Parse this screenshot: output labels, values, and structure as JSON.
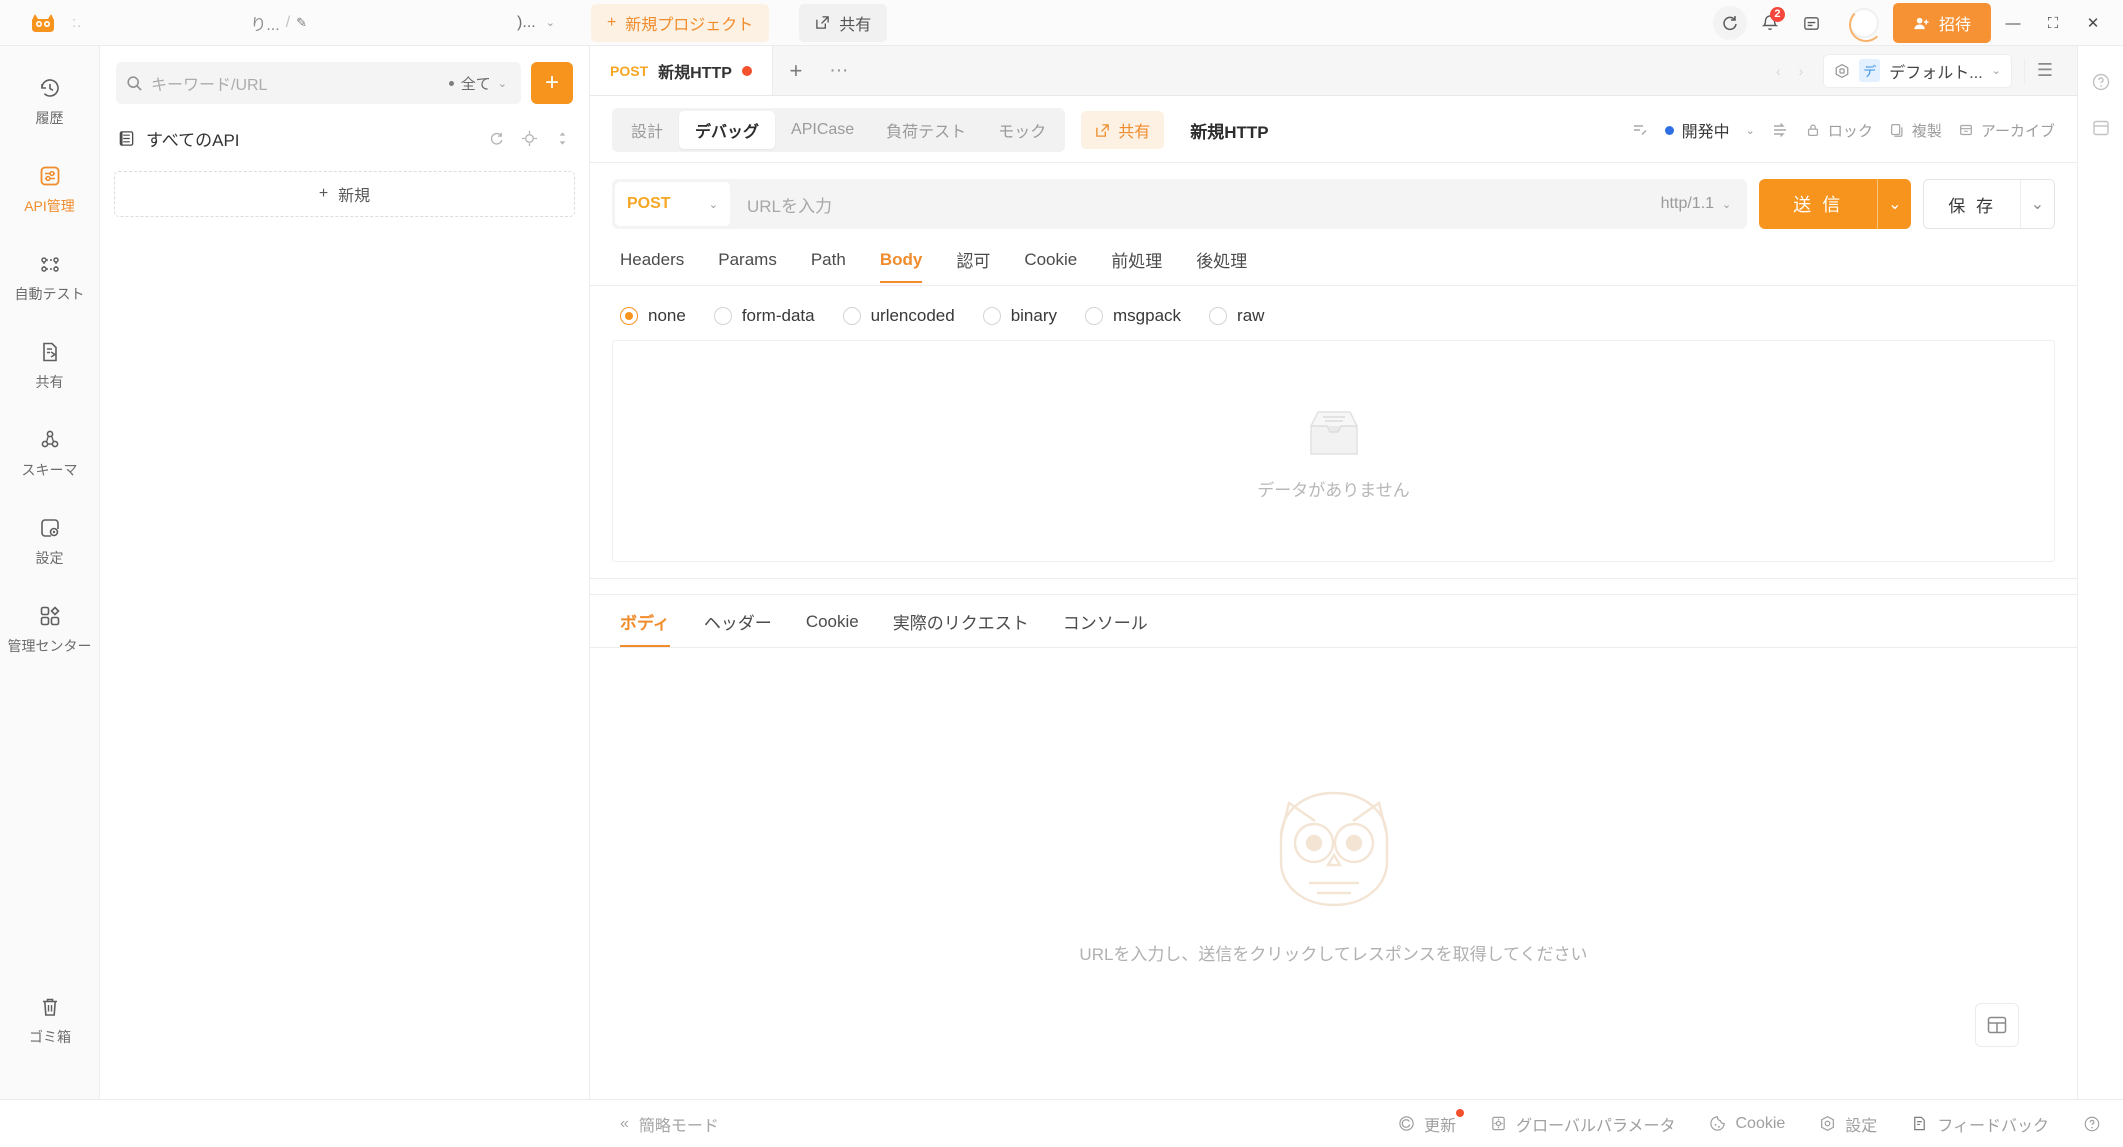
{
  "titlebar": {
    "user_label": ":.",
    "breadcrumb_project": "り...",
    "breadcrumb_sep": "/",
    "team_label": ")...",
    "new_project_label": "新規プロジェクト",
    "share_label": "共有",
    "notification_count": "2",
    "invite_label": "招待",
    "minimize_label": "—",
    "maximize_label": "⛶",
    "close_label": "✕"
  },
  "rail": {
    "items": [
      {
        "label": "履歴",
        "icon": "history-icon",
        "active": false
      },
      {
        "label": "API管理",
        "icon": "api-manage-icon",
        "active": true
      },
      {
        "label": "自動テスト",
        "icon": "auto-test-icon",
        "active": false
      },
      {
        "label": "共有",
        "icon": "share-doc-icon",
        "active": false
      },
      {
        "label": "スキーマ",
        "icon": "schema-icon",
        "active": false
      },
      {
        "label": "設定",
        "icon": "settings-icon",
        "active": false
      },
      {
        "label": "管理センター",
        "icon": "admin-center-icon",
        "active": false
      }
    ],
    "trash_label": "ゴミ箱"
  },
  "tree": {
    "search_placeholder": "キーワード/URL",
    "filter_label": "全て",
    "add_button_label": "+",
    "root_label": "すべてのAPI",
    "new_item_label": "新規"
  },
  "tabstrip": {
    "doc_tab_method": "POST",
    "doc_tab_title": "新規HTTP",
    "add_tab_label": "+",
    "more_label": "···",
    "env_badge": "デ",
    "env_label": "デフォルト..."
  },
  "subheader": {
    "segments": [
      {
        "label": "設計",
        "active": false
      },
      {
        "label": "デバッグ",
        "active": true
      },
      {
        "label": "APICase",
        "active": false
      },
      {
        "label": "負荷テスト",
        "active": false
      },
      {
        "label": "モック",
        "active": false
      }
    ],
    "share_label": "共有",
    "title": "新規HTTP",
    "status_label": "開発中",
    "actions": [
      {
        "label": "ロック",
        "icon": "lock-icon"
      },
      {
        "label": "複製",
        "icon": "copy-icon"
      },
      {
        "label": "アーカイブ",
        "icon": "archive-icon"
      }
    ]
  },
  "urlrow": {
    "method": "POST",
    "url_placeholder": "URLを入力",
    "protocol": "http/1.1",
    "send_label": "送 信",
    "save_label": "保 存"
  },
  "request": {
    "tabs": [
      {
        "label": "Headers",
        "active": false
      },
      {
        "label": "Params",
        "active": false
      },
      {
        "label": "Path",
        "active": false
      },
      {
        "label": "Body",
        "active": true
      },
      {
        "label": "認可",
        "active": false
      },
      {
        "label": "Cookie",
        "active": false
      },
      {
        "label": "前処理",
        "active": false
      },
      {
        "label": "後処理",
        "active": false
      }
    ],
    "body_types": [
      {
        "label": "none",
        "selected": true
      },
      {
        "label": "form-data",
        "selected": false
      },
      {
        "label": "urlencoded",
        "selected": false
      },
      {
        "label": "binary",
        "selected": false
      },
      {
        "label": "msgpack",
        "selected": false
      },
      {
        "label": "raw",
        "selected": false
      }
    ],
    "empty_text": "データがありません"
  },
  "response": {
    "tabs": [
      {
        "label": "ボディ",
        "active": true
      },
      {
        "label": "ヘッダー",
        "active": false
      },
      {
        "label": "Cookie",
        "active": false
      },
      {
        "label": "実際のリクエスト",
        "active": false
      },
      {
        "label": "コンソール",
        "active": false
      }
    ],
    "empty_hint": "URLを入力し、送信をクリックしてレスポンスを取得してください"
  },
  "statusbar": {
    "simple_mode_label": "簡略モード",
    "items": [
      {
        "label": "更新",
        "icon": "refresh-icon",
        "badge": true
      },
      {
        "label": "グローバルパラメータ",
        "icon": "global-params-icon",
        "badge": false
      },
      {
        "label": "Cookie",
        "icon": "cookie-icon",
        "badge": false
      },
      {
        "label": "設定",
        "icon": "settings-gear-icon",
        "badge": false
      },
      {
        "label": "フィードバック",
        "icon": "feedback-icon",
        "badge": false
      }
    ],
    "help_label": "?"
  },
  "colors": {
    "accent": "#f7941e",
    "accent_soft": "#fdf1e4",
    "unsaved_dot": "#f4502e",
    "status_blue": "#2f6fe4",
    "badge_red": "#f5473c"
  }
}
